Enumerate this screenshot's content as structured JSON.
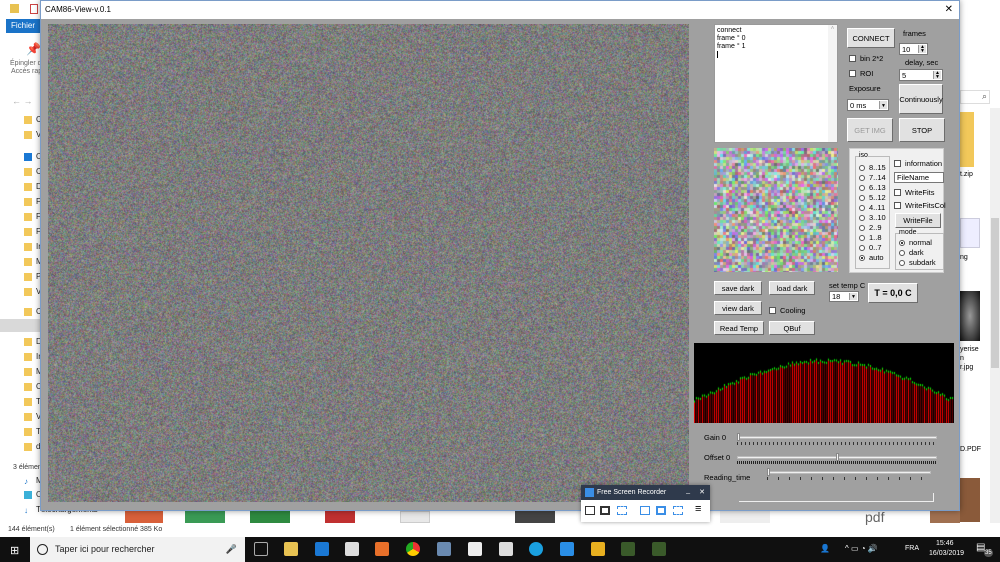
{
  "explorer": {
    "ribbon_tab": "Fichier",
    "pin_label_1": "Épingler d",
    "pin_label_2": "Accès rap",
    "tree_items": [
      "C",
      "V",
      "On",
      "C",
      "D",
      "F",
      "F",
      "F",
      "In",
      "M",
      "P",
      "V",
      "Ce",
      "B",
      "D",
      "In",
      "M",
      "O",
      "T",
      "V",
      "T",
      "d"
    ],
    "status_count_inner": "3 élémen",
    "lower_items": [
      "Mu",
      "Ob",
      "Téléchargements"
    ],
    "status_count": "144 élément(s)",
    "status_selected": "1 élément sélectionné  385 Ko",
    "right_files": [
      "t.zip",
      "ng",
      "yerise",
      "n",
      "r.jpg",
      "D.PDF"
    ]
  },
  "app": {
    "title": "CAM86-View-v.0.1",
    "close_label": "✕",
    "log_lines": [
      "connect",
      "frame ° 0",
      "frame ° 1"
    ],
    "connect": "CONNECT",
    "frames_label": "frames",
    "frames_value": "10",
    "bin_label": "bin 2*2",
    "roi_label": "ROI",
    "delay_label": "delay, sec",
    "delay_value": "5",
    "exposure_label": "Exposure",
    "exposure_value": "0 ms",
    "continuously": "Continuously",
    "get_img": "GET IMG",
    "stop": "STOP",
    "iso_label": "iso",
    "iso_options": [
      "8..15",
      "7..14",
      "6..13",
      "5..12",
      "4..11",
      "3..10",
      "2..9",
      "1..8",
      "0..7",
      "auto"
    ],
    "iso_selected": "auto",
    "information": "information",
    "filename": "FileName",
    "write_fits": "WriteFits",
    "write_fits_col": "WriteFitsCol",
    "write_file": "WriteFile",
    "mode_label": "mode",
    "mode_options": [
      "normal",
      "dark",
      "subdark"
    ],
    "mode_selected": "normal",
    "save_dark": "save dark",
    "load_dark": "load dark",
    "view_dark": "view dark",
    "cooling": "Cooling",
    "read_temp": "Read Temp",
    "qbuf": "QBuf",
    "set_temp_label": "set temp C",
    "set_temp_value": "18",
    "temp_readout": "T = 0,0 C",
    "gain_label": "Gain 0",
    "gain_value": 0,
    "offset_label": "Offset 0",
    "offset_value": 0.5,
    "reading_time_label": "Reading_time",
    "reading_time_value": 0,
    "progress_label": "0",
    "colors": {
      "hist_bg": "#000000",
      "hist_red": "#ff0000",
      "hist_green": "#00ff00"
    }
  },
  "recorder": {
    "title": "Free Screen Recorder",
    "minimize": "_",
    "close": "✕",
    "menu": "≡"
  },
  "taskbar": {
    "search_placeholder": "Taper ici pour rechercher",
    "lang": "FRA",
    "time": "15:46",
    "date": "16/03/2019",
    "notif_count": "35"
  }
}
